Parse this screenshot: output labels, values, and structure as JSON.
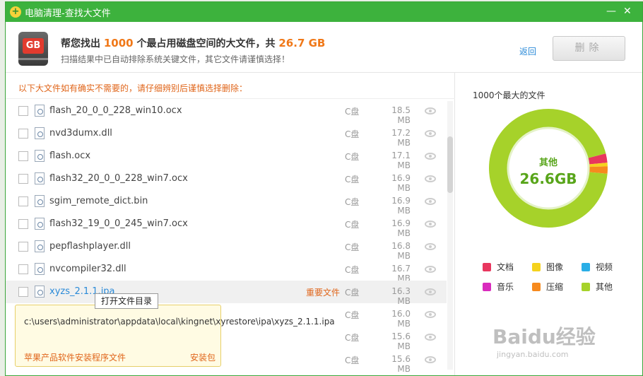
{
  "window": {
    "title": "电脑清理-查找大文件",
    "minimize": "—",
    "close": "✕"
  },
  "header": {
    "prefix": "帮您找出",
    "count": "1000",
    "middle": "个最占用磁盘空间的大文件，共",
    "total": "26.7 GB",
    "subtitle": "扫描结果中已自动排除系统关键文件，其它文件请谨慎选择！",
    "back_label": "返回",
    "delete_label": "删除",
    "icon_text": "GB"
  },
  "list": {
    "warning": "以下大文件如有确实不需要的，请仔细辨别后谨慎选择删除：",
    "rows": [
      {
        "name": "flash_20_0_0_228_win10.ocx",
        "drive": "C盘",
        "size": "18.5 MB"
      },
      {
        "name": "nvd3dumx.dll",
        "drive": "C盘",
        "size": "17.2 MB"
      },
      {
        "name": "flash.ocx",
        "drive": "C盘",
        "size": "17.1 MB"
      },
      {
        "name": "flash32_20_0_0_228_win7.ocx",
        "drive": "C盘",
        "size": "16.9 MB"
      },
      {
        "name": "sgim_remote_dict.bin",
        "drive": "C盘",
        "size": "16.9 MB"
      },
      {
        "name": "flash32_19_0_0_245_win7.ocx",
        "drive": "C盘",
        "size": "16.9 MB"
      },
      {
        "name": "pepflashplayer.dll",
        "drive": "C盘",
        "size": "16.8 MB"
      },
      {
        "name": "nvcompiler32.dll",
        "drive": "C盘",
        "size": "16.7 MB"
      },
      {
        "name": "xyzs_2.1.1.ipa",
        "tag": "重要文件",
        "drive": "C盘",
        "size": "16.3 MB"
      },
      {
        "name": "",
        "drive": "C盘",
        "size": "16.0 MB"
      },
      {
        "name": "",
        "drive": "C盘",
        "size": "15.6 MB"
      },
      {
        "name": "",
        "drive": "C盘",
        "size": "15.6 MB"
      }
    ],
    "tooltip": "打开文件目录",
    "popup": {
      "path": "c:\\users\\administrator\\appdata\\local\\kingnet\\xyrestore\\ipa\\xyzs_2.1.1.ipa",
      "description": "苹果产品软件安装程序文件",
      "type": "安装包"
    }
  },
  "sidebar": {
    "title": "1000个最大的文件",
    "center_label": "其他",
    "center_value": "26.6GB",
    "legend": [
      {
        "label": "文档",
        "color": "#e8365e"
      },
      {
        "label": "图像",
        "color": "#f5d21e"
      },
      {
        "label": "视频",
        "color": "#2aaee6"
      },
      {
        "label": "音乐",
        "color": "#d92bbd"
      },
      {
        "label": "压缩",
        "color": "#f68a1e"
      },
      {
        "label": "其他",
        "color": "#a6d22a"
      }
    ],
    "segments": [
      {
        "label": "文档",
        "fraction": 0.025
      },
      {
        "label": "图像",
        "fraction": 0.01
      },
      {
        "label": "压缩",
        "fraction": 0.02
      },
      {
        "label": "其他",
        "fraction": 0.945
      }
    ]
  },
  "watermark": {
    "main": "Baidu经验",
    "sub": "jingyan.baidu.com"
  }
}
